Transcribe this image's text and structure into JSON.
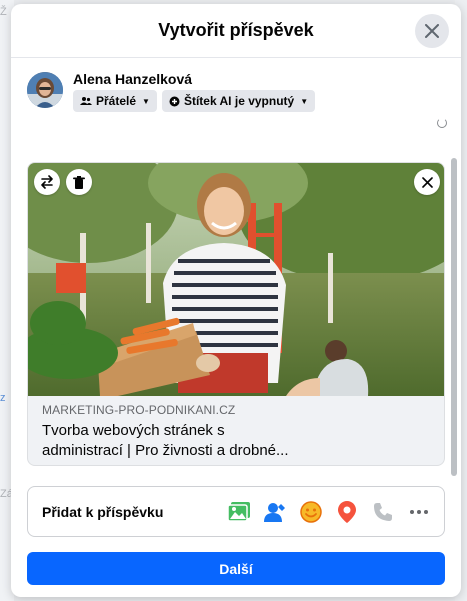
{
  "background": {
    "fragments": [
      "Ž",
      "z",
      "Zá"
    ]
  },
  "dialog": {
    "title": "Vytvořit příspěvek",
    "close_icon": "close-icon"
  },
  "author": {
    "name": "Alena Hanzelková",
    "audience_label": "Přátelé",
    "ai_label": "Štítek AI je vypnutý"
  },
  "link_preview": {
    "domain": "MARKETING-PRO-PODNIKANI.CZ",
    "title_line1": "Tvorba webových stránek s",
    "title_line2": "administrací | Pro živnosti a drobné..."
  },
  "add_to_post": {
    "label": "Přidat k příspěvku",
    "icons": [
      "photo-video-icon",
      "tag-people-icon",
      "feeling-icon",
      "check-in-icon",
      "phone-icon",
      "more-icon"
    ],
    "colors": {
      "photo": "#45bd62",
      "tag": "#1877f2",
      "feeling": "#f7b928",
      "checkin": "#f5533d",
      "phone": "#bcc0c4",
      "more": "#65676b"
    }
  },
  "actions": {
    "next_label": "Další",
    "next_color": "#0866ff"
  }
}
